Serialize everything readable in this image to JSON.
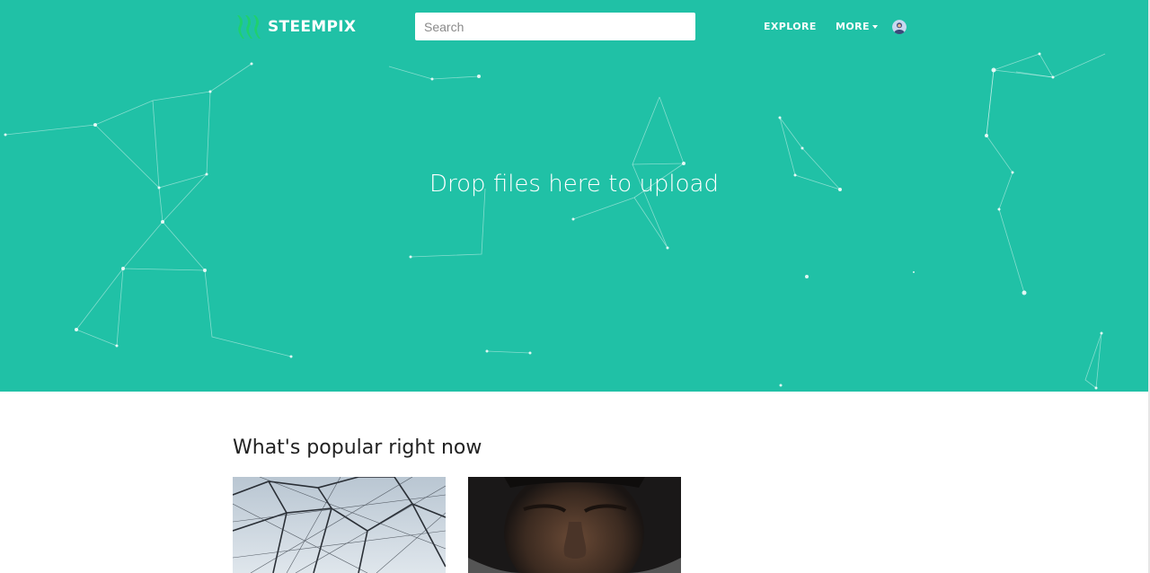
{
  "brand": {
    "name": "STEEMPIX",
    "logo_icon": "steem-logo-icon",
    "accent": "#20c1a6",
    "logo_color": "#1fd06e"
  },
  "search": {
    "placeholder": "Search",
    "value": ""
  },
  "nav": {
    "explore_label": "EXPLORE",
    "more_label": "MORE"
  },
  "hero": {
    "drop_text": "Drop files here to upload"
  },
  "popular": {
    "title": "What's popular right now",
    "cards": [
      {
        "image": "geodesic-steel-structure"
      },
      {
        "image": "portrait-man-looking-down"
      }
    ]
  }
}
